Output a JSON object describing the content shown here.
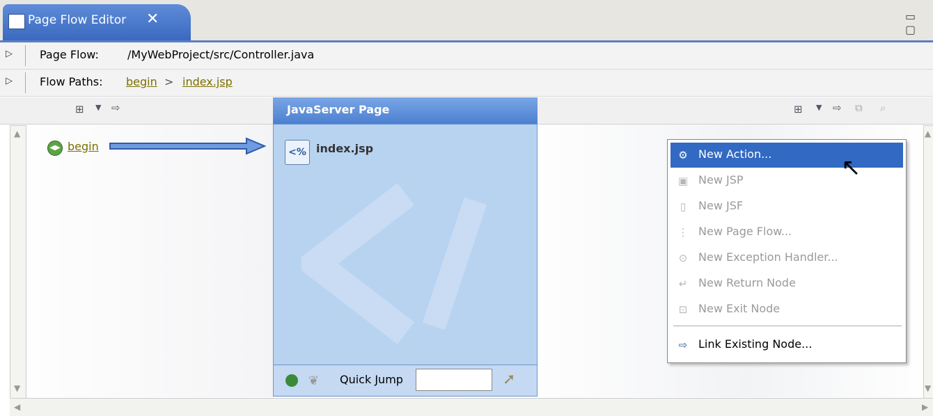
{
  "tab": {
    "title": "Page Flow Editor",
    "close": "✕"
  },
  "header": {
    "page_flow_label": "Page Flow:",
    "page_flow_path": "/MyWebProject/src/Controller.java",
    "flow_paths_label": "Flow Paths:",
    "flow_path_items": [
      "begin",
      "index.jsp"
    ],
    "flow_path_separator": ">"
  },
  "canvas": {
    "begin_label": "begin",
    "jsp_column_title": "JavaServer Page",
    "jsp_node_name": "index.jsp",
    "quick_jump_label": "Quick Jump",
    "quick_jump_value": ""
  },
  "context_menu": {
    "items": [
      {
        "label": "New Action...",
        "icon": "new-action-icon",
        "enabled": true,
        "selected": true
      },
      {
        "label": "New JSP",
        "icon": "jsp-icon",
        "enabled": false
      },
      {
        "label": "New JSF",
        "icon": "jsf-icon",
        "enabled": false
      },
      {
        "label": "New Page Flow...",
        "icon": "page-flow-icon",
        "enabled": false
      },
      {
        "label": "New Exception Handler...",
        "icon": "exception-handler-icon",
        "enabled": false
      },
      {
        "label": "New Return Node",
        "icon": "return-node-icon",
        "enabled": false
      },
      {
        "label": "New Exit Node",
        "icon": "exit-node-icon",
        "enabled": false
      },
      {
        "label": "Link Existing Node...",
        "icon": "link-node-icon",
        "enabled": true
      }
    ]
  },
  "colors": {
    "accent": "#3269c2",
    "jsp_column": "#b8d3f0",
    "link": "#7a6f00"
  }
}
